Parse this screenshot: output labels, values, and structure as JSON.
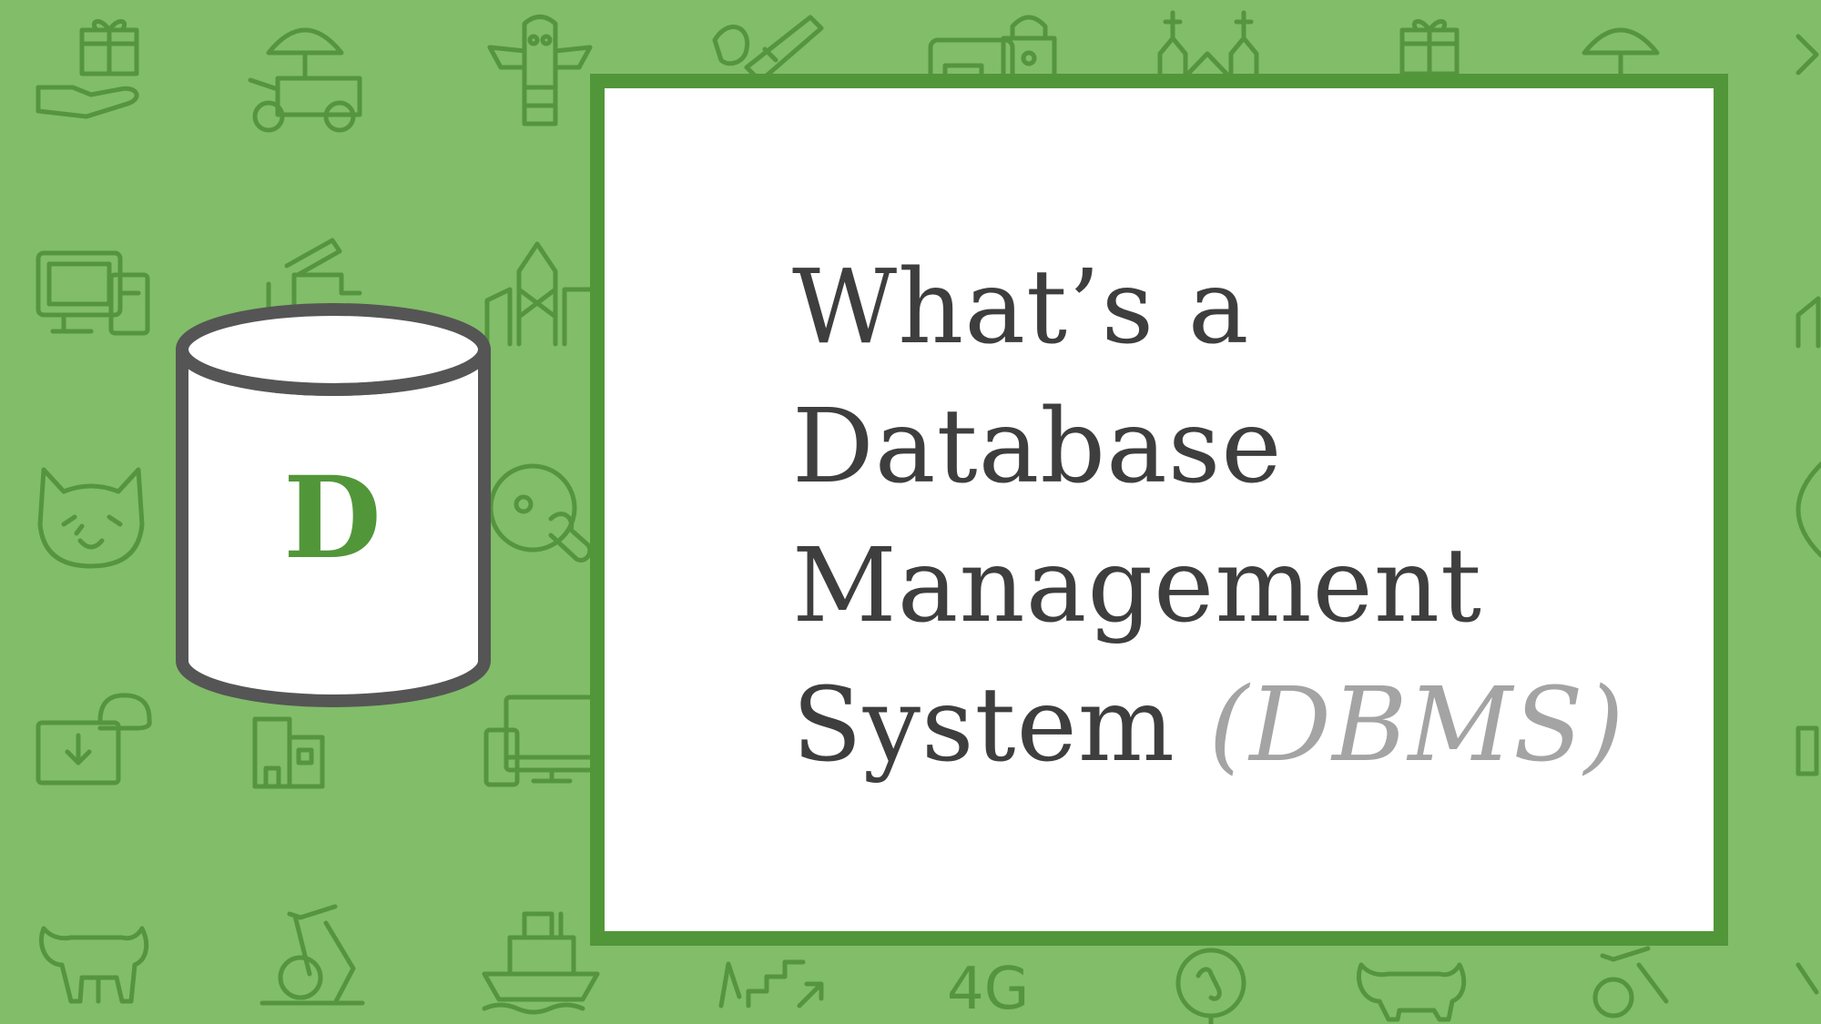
{
  "background": {
    "color": "#82bd69",
    "pattern_color": "#56953f",
    "pattern_icons": [
      "gift-hand-icon",
      "food-cart-icon",
      "totem-icon",
      "art-tools-icon",
      "lock-card-icon",
      "churches-icon",
      "computer-devices-icon",
      "faucet-icon",
      "city-buildings-icon",
      "cat-face-icon",
      "music-disc-icon",
      "cloud-download-icon",
      "building-icon",
      "devices-icon",
      "bull-icon",
      "exercise-bike-icon",
      "ship-icon",
      "stairs-growth-icon",
      "network-4g-icon",
      "globe-phone-icon"
    ],
    "pattern_text": "4G"
  },
  "logo": {
    "icon": "database-cylinder-icon",
    "letter": "D",
    "outline_color": "#555555",
    "letter_color": "#52963a"
  },
  "card": {
    "border_color": "#52963a",
    "title_lines": [
      "What’s a",
      "Database",
      "Management",
      "System"
    ],
    "abbreviation": "(DBMS)",
    "title_color": "#3e3e3e",
    "abbreviation_color": "#a4a4a4"
  }
}
